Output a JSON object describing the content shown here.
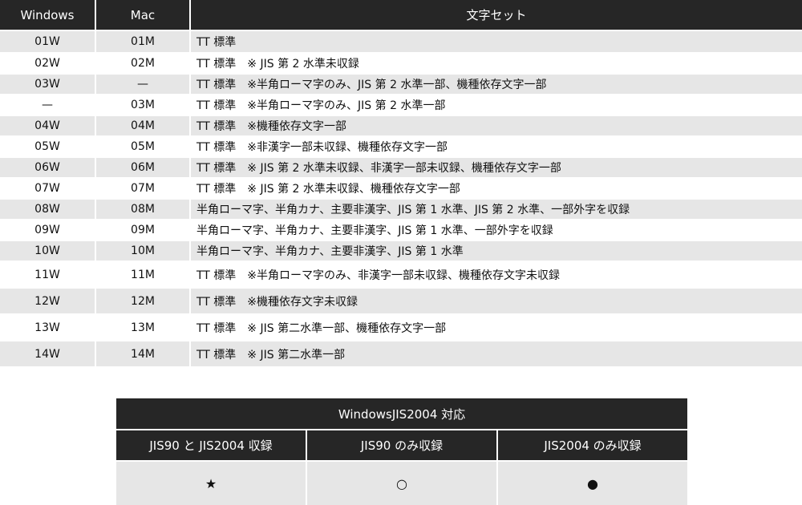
{
  "main_table": {
    "headers": [
      "Windows",
      "Mac",
      "文字セット"
    ],
    "rows": [
      {
        "win": "01W",
        "mac": "01M",
        "charset": "TT 標準"
      },
      {
        "win": "02W",
        "mac": "02M",
        "charset": "TT 標準　※ JIS 第 2 水準未収録"
      },
      {
        "win": "03W",
        "mac": "—",
        "charset": "TT 標準　※半角ローマ字のみ、JIS 第 2 水準一部、機種依存文字一部"
      },
      {
        "win": "—",
        "mac": "03M",
        "charset": "TT 標準　※半角ローマ字のみ、JIS 第 2 水準一部"
      },
      {
        "win": "04W",
        "mac": "04M",
        "charset": "TT 標準　※機種依存文字一部"
      },
      {
        "win": "05W",
        "mac": "05M",
        "charset": "TT 標準　※非漢字一部未収録、機種依存文字一部"
      },
      {
        "win": "06W",
        "mac": "06M",
        "charset": "TT 標準　※ JIS 第 2 水準未収録、非漢字一部未収録、機種依存文字一部"
      },
      {
        "win": "07W",
        "mac": "07M",
        "charset": "TT 標準　※ JIS 第 2 水準未収録、機種依存文字一部"
      },
      {
        "win": "08W",
        "mac": "08M",
        "charset": "半角ローマ字、半角カナ、主要非漢字、JIS 第 1 水準、JIS 第 2 水準、一部外字を収録"
      },
      {
        "win": "09W",
        "mac": "09M",
        "charset": "半角ローマ字、半角カナ、主要非漢字、JIS 第 1 水準、一部外字を収録"
      },
      {
        "win": "10W",
        "mac": "10M",
        "charset": "半角ローマ字、半角カナ、主要非漢字、JIS 第 1 水準"
      },
      {
        "win": "11W",
        "mac": "11M",
        "charset": "TT 標準　※半角ローマ字のみ、非漢字一部未収録、機種依存文字未収録"
      },
      {
        "win": "12W",
        "mac": "12M",
        "charset": "TT 標準　※機種依存文字未収録"
      },
      {
        "win": "13W",
        "mac": "13M",
        "charset": "TT 標準　※ JIS 第二水準一部、機種依存文字一部"
      },
      {
        "win": "14W",
        "mac": "14M",
        "charset": "TT 標準　※ JIS 第二水準一部"
      }
    ]
  },
  "jis_table": {
    "title": "WindowsJIS2004 対応",
    "headers": [
      "JIS90 と JIS2004 収録",
      "JIS90 のみ収録",
      "JIS2004 のみ収録"
    ],
    "symbols": [
      "★",
      "○",
      "●"
    ]
  }
}
